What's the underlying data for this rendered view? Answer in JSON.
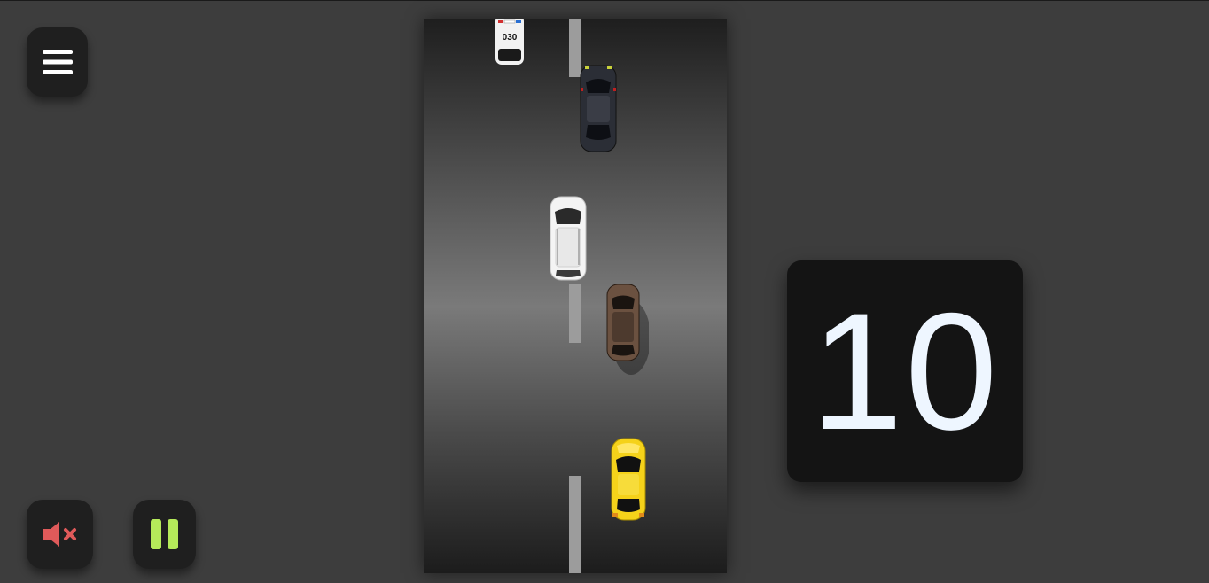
{
  "game": {
    "score": "10"
  },
  "controls": {
    "menu_icon": "hamburger-menu-icon",
    "mute_icon": "speaker-muted-icon",
    "pause_icon": "pause-icon"
  },
  "road": {
    "police_car_number": "030"
  },
  "colors": {
    "background": "#3d3d3d",
    "button_bg": "#1f1f1f",
    "mute_icon": "#e05a5a",
    "pause_icon": "#b5ea5a",
    "player_car": "#f5d21a",
    "score_text": "#eef6ff"
  }
}
